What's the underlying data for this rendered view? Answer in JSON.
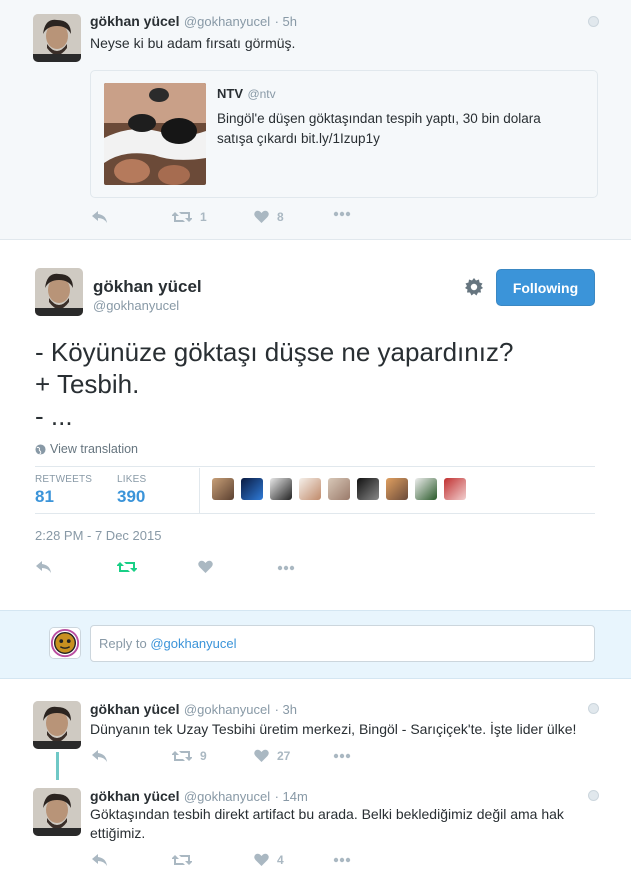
{
  "prev_tweet": {
    "name": "gökhan yücel",
    "handle": "@gokhanyucel",
    "time": "· 5h",
    "text": "Neyse ki bu adam fırsatı görmüş.",
    "quote": {
      "name": "NTV",
      "handle": "@ntv",
      "text": "Bingöl'e düşen göktaşından tespih yaptı, 30 bin dolara satışa çıkardı bit.ly/1Izup1y"
    },
    "retweets": "1",
    "likes": "8"
  },
  "main_tweet": {
    "name": "gökhan yücel",
    "handle": "@gokhanyucel",
    "follow_label": "Following",
    "text_lines": [
      "- Köyünüze göktaşı düşse ne yapardınız?",
      "+ Tesbih.",
      "- ..."
    ],
    "view_translation": "View translation",
    "retweets_label": "RETWEETS",
    "retweets": "81",
    "likes_label": "LIKES",
    "likes": "390",
    "timestamp": "2:28 PM - 7 Dec 2015"
  },
  "reply_box": {
    "prefix": "Reply to ",
    "mention": "@gokhanyucel"
  },
  "replies": [
    {
      "name": "gökhan yücel",
      "handle": "@gokhanyucel",
      "time": "· 3h",
      "text": "Dünyanın tek Uzay Tesbihi üretim merkezi, Bingöl - Sarıçiçek'te. İşte lider ülke!",
      "retweets": "9",
      "likes": "27"
    },
    {
      "name": "gökhan yücel",
      "handle": "@gokhanyucel",
      "time": "· 14m",
      "text": "Göktaşından tesbih direkt artifact bu arada. Belki beklediğimiz değil ama hak ettiğimiz.",
      "retweets": "",
      "likes": "4"
    }
  ],
  "colors": {
    "accent": "#3b94d9",
    "retweet_active": "#19cf86",
    "muted": "#aab8c2"
  }
}
